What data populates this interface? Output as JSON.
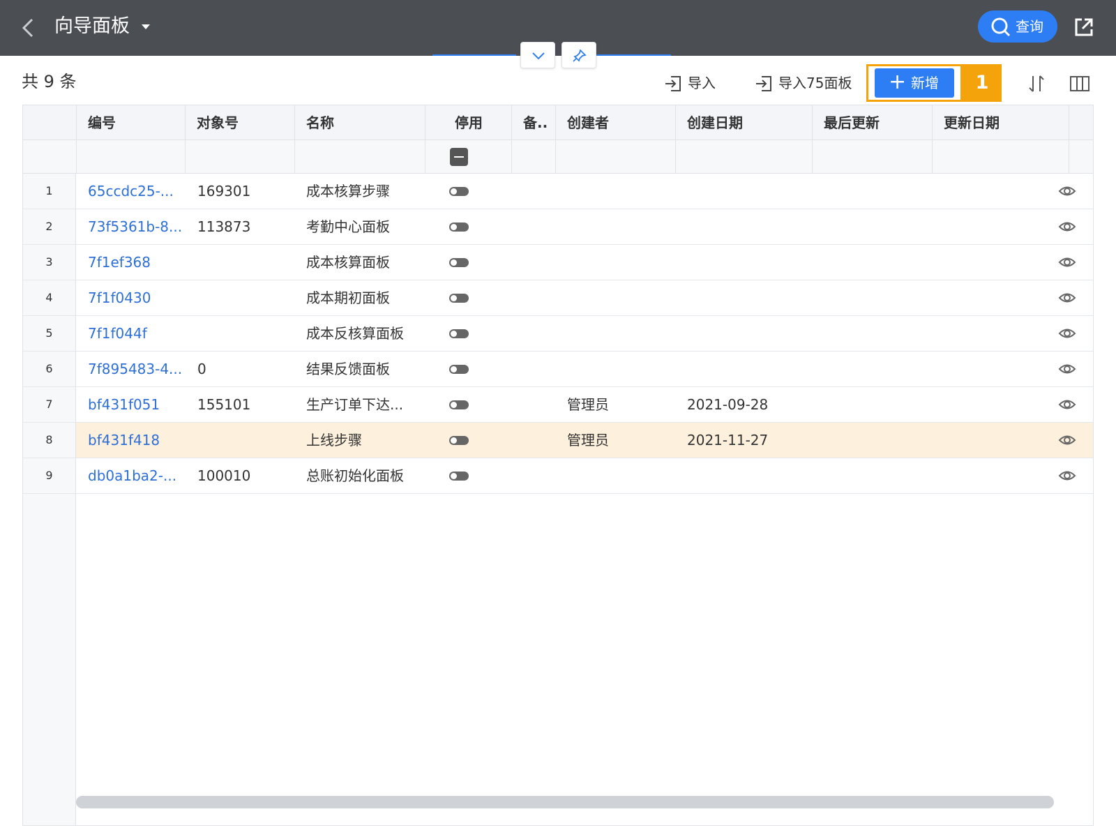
{
  "header": {
    "title": "向导面板",
    "search_label": "查询"
  },
  "toolbar": {
    "count_label": "共 9 条",
    "import_label": "导入",
    "import75_label": "导入75面板",
    "add_label": "新增",
    "step_badge": "1"
  },
  "table": {
    "columns": [
      "编号",
      "对象号",
      "名称",
      "停用",
      "备..",
      "创建者",
      "创建日期",
      "最后更新",
      "更新日期"
    ],
    "rows": [
      {
        "num": "1",
        "code": "65ccdc25-...",
        "obj": "169301",
        "name": "成本核算步骤",
        "creator": "",
        "created": ""
      },
      {
        "num": "2",
        "code": "73f5361b-8...",
        "obj": "113873",
        "name": "考勤中心面板",
        "creator": "",
        "created": ""
      },
      {
        "num": "3",
        "code": "7f1ef368",
        "obj": "",
        "name": "成本核算面板",
        "creator": "",
        "created": ""
      },
      {
        "num": "4",
        "code": "7f1f0430",
        "obj": "",
        "name": "成本期初面板",
        "creator": "",
        "created": ""
      },
      {
        "num": "5",
        "code": "7f1f044f",
        "obj": "",
        "name": "成本反核算面板",
        "creator": "",
        "created": ""
      },
      {
        "num": "6",
        "code": "7f895483-4...",
        "obj": "0",
        "name": "结果反馈面板",
        "creator": "",
        "created": ""
      },
      {
        "num": "7",
        "code": "bf431f051",
        "obj": "155101",
        "name": "生产订单下达...",
        "creator": "管理员",
        "created": "2021-09-28"
      },
      {
        "num": "8",
        "code": "bf431f418",
        "obj": "",
        "name": "上线步骤",
        "creator": "管理员",
        "created": "2021-11-27",
        "selected": true
      },
      {
        "num": "9",
        "code": "db0a1ba2-...",
        "obj": "100010",
        "name": "总账初始化面板",
        "creator": "",
        "created": ""
      }
    ]
  },
  "colors": {
    "header_bg": "#4b4f54",
    "accent": "#2d7ef5",
    "link": "#2d6fd6",
    "highlight": "#f4a30b",
    "selected_row": "#fdf0dc"
  }
}
